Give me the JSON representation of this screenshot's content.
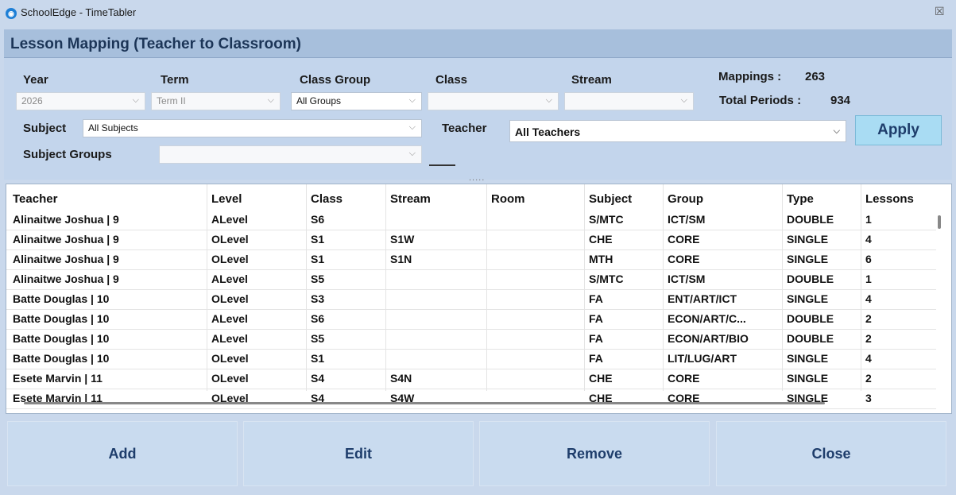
{
  "window": {
    "title": "SchoolEdge - TimeTabler",
    "close_glyph": "☒",
    "app_icon_glyph": "◉"
  },
  "header": {
    "title": "Lesson Mapping (Teacher to Classroom)"
  },
  "filters": {
    "year": {
      "label": "Year",
      "value": "2026"
    },
    "term": {
      "label": "Term",
      "value": "Term II"
    },
    "class_group": {
      "label": "Class Group",
      "value": "All Groups"
    },
    "class": {
      "label": "Class",
      "value": ""
    },
    "stream": {
      "label": "Stream",
      "value": ""
    },
    "subject": {
      "label": "Subject",
      "value": "All Subjects"
    },
    "teacher": {
      "label": "Teacher",
      "value": "All Teachers"
    },
    "subject_groups": {
      "label": "Subject Groups",
      "value": ""
    },
    "apply_label": "Apply",
    "chevron": "⌵"
  },
  "stats": {
    "mappings_label": "Mappings :",
    "mappings_value": "263",
    "total_periods_label": "Total Periods :",
    "total_periods_value": "934"
  },
  "grip": ".....",
  "table": {
    "headers": [
      "Teacher",
      "Level",
      "Class",
      "Stream",
      "Room",
      "Subject",
      "Group",
      "Type",
      "Lessons"
    ],
    "rows": [
      [
        "Alinaitwe Joshua | 9",
        "ALevel",
        "S6",
        "",
        "",
        "S/MTC",
        "ICT/SM",
        "DOUBLE",
        "1"
      ],
      [
        "Alinaitwe Joshua | 9",
        "OLevel",
        "S1",
        "S1W",
        "",
        "CHE",
        "CORE",
        "SINGLE",
        "4"
      ],
      [
        "Alinaitwe Joshua | 9",
        "OLevel",
        "S1",
        "S1N",
        "",
        "MTH",
        "CORE",
        "SINGLE",
        "6"
      ],
      [
        "Alinaitwe Joshua | 9",
        "ALevel",
        "S5",
        "",
        "",
        "S/MTC",
        "ICT/SM",
        "DOUBLE",
        "1"
      ],
      [
        "Batte Douglas | 10",
        "OLevel",
        "S3",
        "",
        "",
        "FA",
        "ENT/ART/ICT",
        "SINGLE",
        "4"
      ],
      [
        "Batte Douglas | 10",
        "ALevel",
        "S6",
        "",
        "",
        "FA",
        "ECON/ART/C...",
        "DOUBLE",
        "2"
      ],
      [
        "Batte Douglas | 10",
        "ALevel",
        "S5",
        "",
        "",
        "FA",
        "ECON/ART/BIO",
        "DOUBLE",
        "2"
      ],
      [
        "Batte Douglas | 10",
        "OLevel",
        "S1",
        "",
        "",
        "FA",
        "LIT/LUG/ART",
        "SINGLE",
        "4"
      ],
      [
        "Esete Marvin | 11",
        "OLevel",
        "S4",
        "S4N",
        "",
        "CHE",
        "CORE",
        "SINGLE",
        "2"
      ],
      [
        "Esete Marvin | 11",
        "OLevel",
        "S4",
        "S4W",
        "",
        "CHE",
        "CORE",
        "SINGLE",
        "3"
      ]
    ]
  },
  "buttons": {
    "add": "Add",
    "edit": "Edit",
    "remove": "Remove",
    "close": "Close"
  }
}
